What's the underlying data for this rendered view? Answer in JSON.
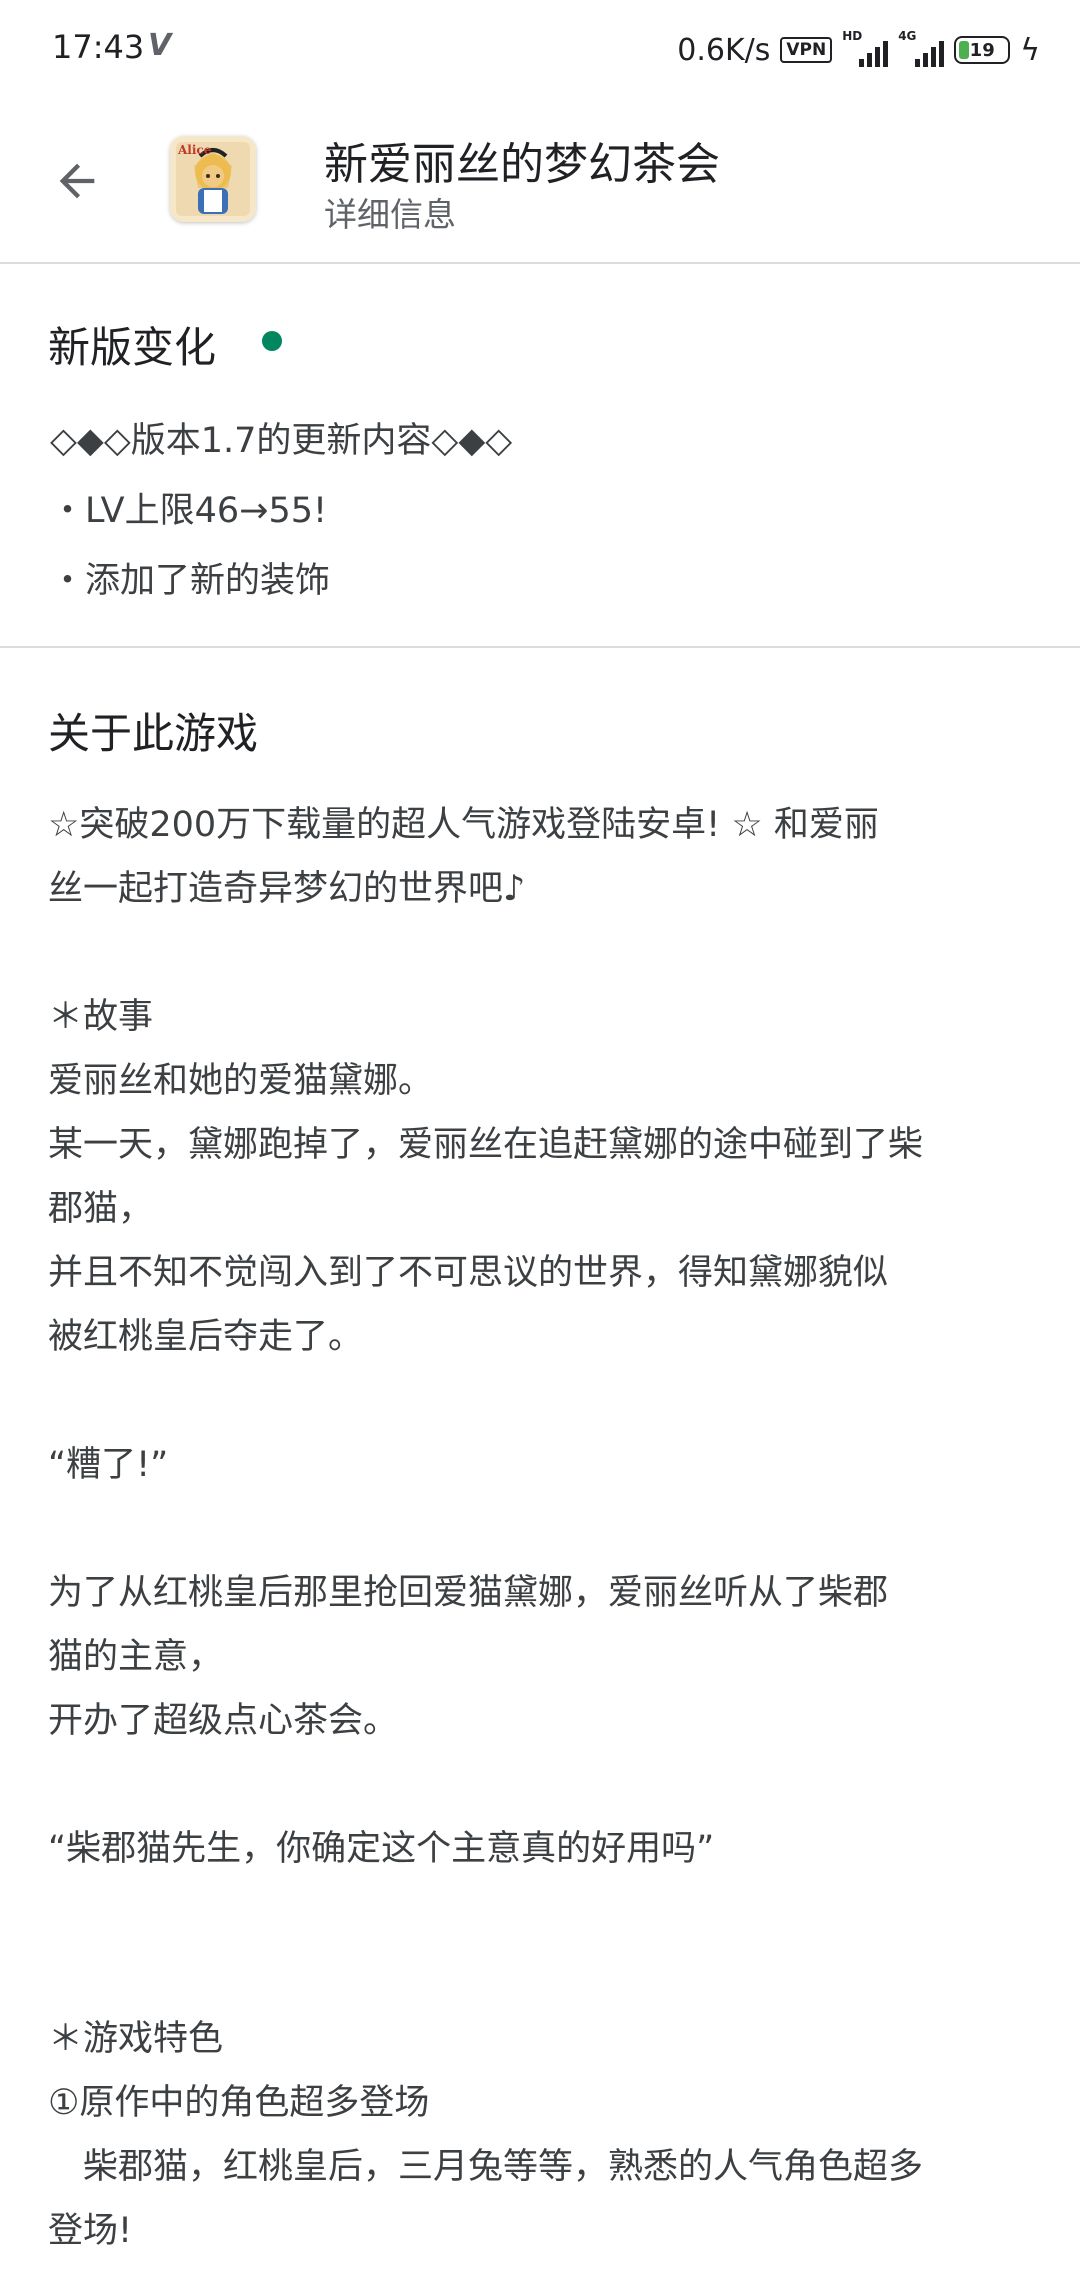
{
  "status_bar": {
    "time": "17:43",
    "net_speed": "0.6K/s",
    "vpn_label": "VPN",
    "signal_1_label": "HD",
    "signal_2_label": "4G",
    "battery_level": "19",
    "battery_color": "#4caf50"
  },
  "header": {
    "app_title": "新爱丽丝的梦幻茶会",
    "subtitle": "详细信息",
    "icon_badge": "Alice"
  },
  "whats_new": {
    "heading": "新版变化",
    "dot_color": "#01875f",
    "lines": [
      "◇◆◇版本1.7的更新内容◇◆◇",
      "・LV上限46→55!",
      "・添加了新的装饰"
    ]
  },
  "about": {
    "heading": "关于此游戏",
    "lines": [
      "☆突破200万下载量的超人气游戏登陆安卓! ☆ 和爱丽",
      "丝一起打造奇异梦幻的世界吧♪",
      "＊故事",
      "爱丽丝和她的爱猫黛娜。",
      "某一天，黛娜跑掉了，爱丽丝在追赶黛娜的途中碰到了柴",
      "郡猫，",
      "并且不知不觉闯入到了不可思议的世界，得知黛娜貌似",
      "被红桃皇后夺走了。",
      "“糟了!”",
      "为了从红桃皇后那里抢回爱猫黛娜，爱丽丝听从了柴郡",
      "猫的主意，",
      "开办了超级点心茶会。",
      "“柴郡猫先生，你确定这个主意真的好用吗”",
      "＊游戏特色",
      "①原作中的角色超多登场",
      "　柴郡猫，红桃皇后，三月兔等等，熟悉的人气角色超多",
      "登场!"
    ]
  }
}
